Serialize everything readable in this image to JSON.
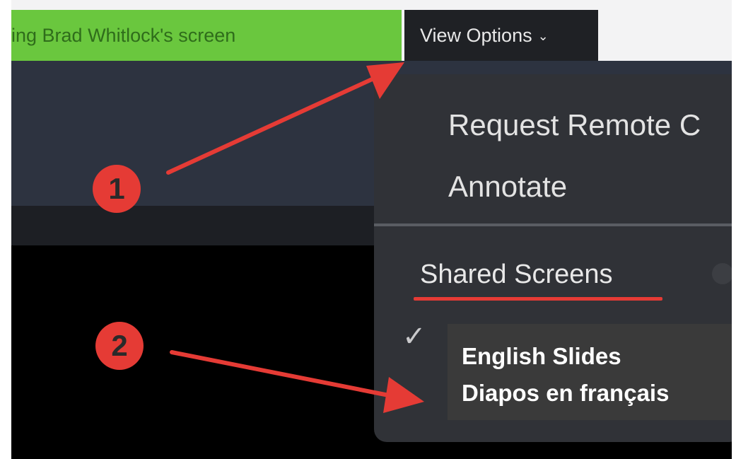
{
  "share_banner": {
    "text": "ing Brad Whitlock's screen"
  },
  "view_options": {
    "label": "View Options",
    "chevron": "chevron-down-icon"
  },
  "menu": {
    "items": [
      {
        "label": "Request Remote C"
      },
      {
        "label": "Annotate"
      }
    ],
    "section_label": "Shared Screens",
    "checked_icon": "checkmark-icon"
  },
  "overlay": {
    "line1": "English Slides",
    "line2": "Diapos en français"
  },
  "callouts": {
    "one": "1",
    "two": "2"
  },
  "colors": {
    "banner_green": "#6ac73e",
    "menu_bg": "#303237",
    "callout_red": "#e53b35",
    "panel_bg": "#2d3340"
  }
}
